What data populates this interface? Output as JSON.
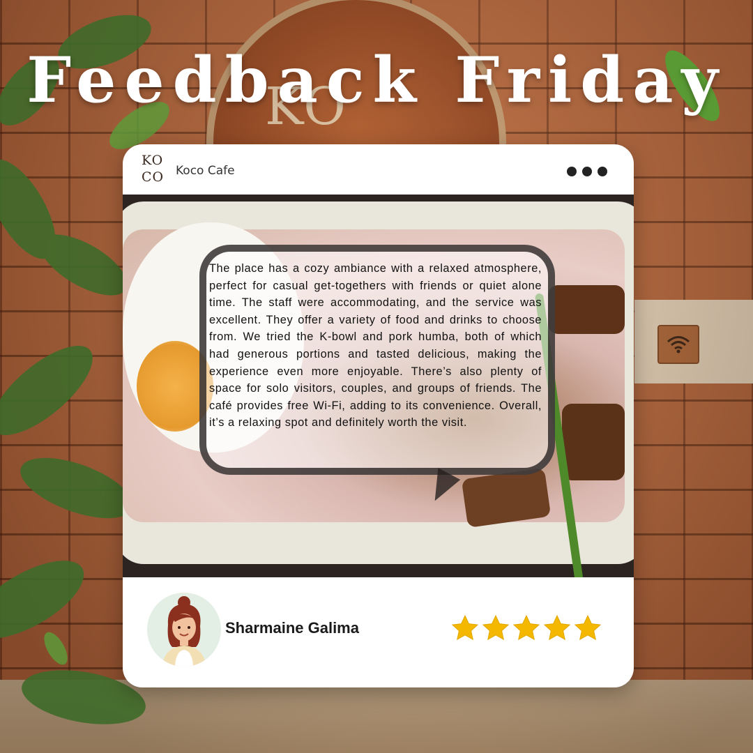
{
  "headline": "Feedback Friday",
  "sign": {
    "text": "KO"
  },
  "card": {
    "logo_top": "KO",
    "logo_bottom": "CO",
    "account_name": "Koco Cafe",
    "menu_icon": "more-horizontal-icon",
    "review_text": "The place has a cozy ambiance with a relaxed atmosphere, perfect for casual get-togethers with friends or quiet alone time. The staff were accommodating, and the service was excellent. They offer a variety of food and drinks to choose from. We tried the K-bowl and pork humba, both of which had generous portions and tasted delicious, making the experience even more enjoyable. There’s also plenty of space for solo visitors, couples, and groups of friends. The café provides free Wi-Fi, adding to its convenience. Overall, it’s a relaxing spot and definitely worth the visit.",
    "reviewer_name": "Sharmaine Galima",
    "rating": 5,
    "rating_max": 5
  },
  "colors": {
    "star": "#f5b800",
    "card_bg": "#ffffff",
    "bubble_border": "#231e1e"
  }
}
